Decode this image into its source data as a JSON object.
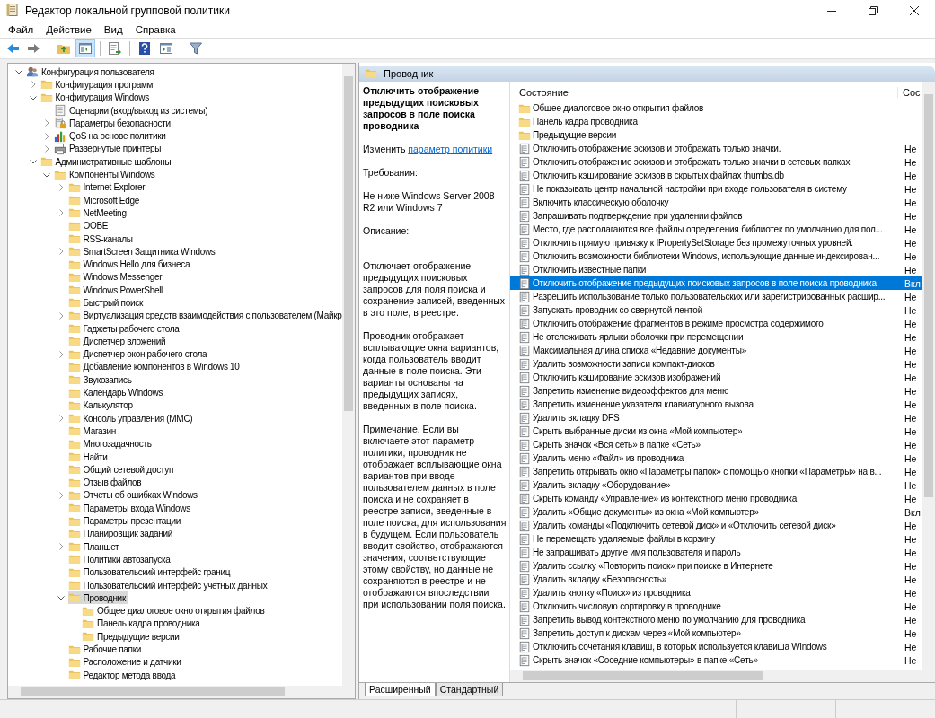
{
  "window": {
    "title": "Редактор локальной групповой политики"
  },
  "menu": [
    "Файл",
    "Действие",
    "Вид",
    "Справка"
  ],
  "toolbar": [
    [
      {
        "kind": "back",
        "pressed": false
      },
      {
        "kind": "forward",
        "pressed": false
      }
    ],
    [
      {
        "kind": "up",
        "pressed": false
      },
      {
        "kind": "tree",
        "pressed": true
      }
    ],
    [
      {
        "kind": "export",
        "pressed": false
      }
    ],
    [
      {
        "kind": "help",
        "pressed": false
      },
      {
        "kind": "pane",
        "pressed": false
      }
    ],
    [
      {
        "kind": "filter",
        "pressed": false
      }
    ]
  ],
  "tree": [
    {
      "label": "Конфигурация пользователя",
      "kind": "user",
      "expanded": true,
      "selected": false,
      "children": [
        {
          "label": "Конфигурация программ",
          "kind": "folder",
          "expanded": false,
          "selected": false
        },
        {
          "label": "Конфигурация Windows",
          "kind": "folder",
          "expanded": true,
          "selected": false,
          "children": [
            {
              "label": "Сценарии (вход/выход из системы)",
              "kind": "script",
              "selected": false
            },
            {
              "label": "Параметры безопасности",
              "kind": "security",
              "expanded": false,
              "selected": false
            },
            {
              "label": "QoS на основе политики",
              "kind": "chart",
              "expanded": false,
              "selected": false
            },
            {
              "label": "Развернутые принтеры",
              "kind": "printer",
              "expanded": false,
              "selected": false
            }
          ]
        },
        {
          "label": "Административные шаблоны",
          "kind": "folder",
          "expanded": true,
          "selected": false,
          "children": [
            {
              "label": "Компоненты Windows",
              "kind": "folder",
              "expanded": true,
              "selected": false,
              "children": [
                {
                  "label": "Internet Explorer",
                  "kind": "folder",
                  "expanded": false,
                  "selected": false
                },
                {
                  "label": "Microsoft Edge",
                  "kind": "folder",
                  "selected": false
                },
                {
                  "label": "NetMeeting",
                  "kind": "folder",
                  "expanded": false,
                  "selected": false
                },
                {
                  "label": "OOBE",
                  "kind": "folder",
                  "selected": false
                },
                {
                  "label": "RSS-каналы",
                  "kind": "folder",
                  "selected": false
                },
                {
                  "label": "SmartScreen Защитника Windows",
                  "kind": "folder",
                  "expanded": false,
                  "selected": false
                },
                {
                  "label": "Windows Hello для бизнеса",
                  "kind": "folder",
                  "selected": false
                },
                {
                  "label": "Windows Messenger",
                  "kind": "folder",
                  "selected": false
                },
                {
                  "label": "Windows PowerShell",
                  "kind": "folder",
                  "selected": false
                },
                {
                  "label": "Быстрый поиск",
                  "kind": "folder",
                  "selected": false
                },
                {
                  "label": "Виртуализация средств взаимодействия с пользователем (Майкр",
                  "kind": "folder",
                  "expanded": false,
                  "selected": false
                },
                {
                  "label": "Гаджеты рабочего стола",
                  "kind": "folder",
                  "selected": false
                },
                {
                  "label": "Диспетчер вложений",
                  "kind": "folder",
                  "selected": false
                },
                {
                  "label": "Диспетчер окон рабочего стола",
                  "kind": "folder",
                  "expanded": false,
                  "selected": false
                },
                {
                  "label": "Добавление компонентов в Windows 10",
                  "kind": "folder",
                  "selected": false
                },
                {
                  "label": "Звукозапись",
                  "kind": "folder",
                  "selected": false
                },
                {
                  "label": "Календарь Windows",
                  "kind": "folder",
                  "selected": false
                },
                {
                  "label": "Калькулятор",
                  "kind": "folder",
                  "selected": false
                },
                {
                  "label": "Консоль управления (MMC)",
                  "kind": "folder",
                  "expanded": false,
                  "selected": false
                },
                {
                  "label": "Магазин",
                  "kind": "folder",
                  "selected": false
                },
                {
                  "label": "Многозадачность",
                  "kind": "folder",
                  "selected": false
                },
                {
                  "label": "Найти",
                  "kind": "folder",
                  "selected": false
                },
                {
                  "label": "Общий сетевой доступ",
                  "kind": "folder",
                  "selected": false
                },
                {
                  "label": "Отзыв файлов",
                  "kind": "folder",
                  "selected": false
                },
                {
                  "label": "Отчеты об ошибках Windows",
                  "kind": "folder",
                  "expanded": false,
                  "selected": false
                },
                {
                  "label": "Параметры входа Windows",
                  "kind": "folder",
                  "selected": false
                },
                {
                  "label": "Параметры презентации",
                  "kind": "folder",
                  "selected": false
                },
                {
                  "label": "Планировщик заданий",
                  "kind": "folder",
                  "selected": false
                },
                {
                  "label": "Планшет",
                  "kind": "folder",
                  "expanded": false,
                  "selected": false
                },
                {
                  "label": "Политики автозапуска",
                  "kind": "folder",
                  "selected": false
                },
                {
                  "label": "Пользовательский интерфейс границ",
                  "kind": "folder",
                  "selected": false
                },
                {
                  "label": "Пользовательский интерфейс учетных данных",
                  "kind": "folder",
                  "selected": false
                },
                {
                  "label": "Проводник",
                  "kind": "folder",
                  "expanded": true,
                  "selected": true,
                  "children": [
                    {
                      "label": "Общее диалоговое окно открытия файлов",
                      "kind": "folder",
                      "selected": false
                    },
                    {
                      "label": "Панель кадра проводника",
                      "kind": "folder",
                      "selected": false
                    },
                    {
                      "label": "Предыдущие версии",
                      "kind": "folder",
                      "selected": false
                    }
                  ]
                },
                {
                  "label": "Рабочие папки",
                  "kind": "folder",
                  "selected": false
                },
                {
                  "label": "Расположение и датчики",
                  "kind": "folder",
                  "selected": false
                },
                {
                  "label": "Редактор метода ввода",
                  "kind": "folder",
                  "selected": false
                }
              ]
            }
          ]
        }
      ]
    }
  ],
  "details": {
    "header": "Проводник",
    "policy_title": "Отключить отображение предыдущих поисковых запросов в поле поиска проводника",
    "edit_prefix": "Изменить",
    "edit_link": "параметр политики",
    "requirements_label": "Требования:",
    "requirements": "Не ниже Windows Server 2008 R2 или Windows 7",
    "description_label": "Описание:",
    "paragraphs": [
      "Отключает отображение предыдущих поисковых запросов для поля поиска и сохранение записей, введенных в это поле, в реестре.",
      "Проводник отображает всплывающие окна вариантов, когда пользователь вводит данные в поле поиска. Эти варианты основаны на предыдущих записях, введенных в поле поиска.",
      "Примечание. Если вы включаете этот параметр политики, проводник не отображает всплывающие окна вариантов при вводе пользователем данных в поле поиска и не сохраняет в реестре записи, введенные в поле поиска, для использования в будущем. Если пользователь вводит свойство, отображаются значения, соответствующие этому свойству, но данные не сохраняются в реестре и не отображаются впоследствии при использовании поля поиска."
    ]
  },
  "list": {
    "columns": [
      "Состояние",
      "Сос"
    ],
    "rows": [
      {
        "kind": "folder",
        "name": "Общее диалоговое окно открытия файлов",
        "selected": false
      },
      {
        "kind": "folder",
        "name": "Панель кадра проводника",
        "selected": false
      },
      {
        "kind": "folder",
        "name": "Предыдущие версии",
        "selected": false
      },
      {
        "kind": "setting",
        "name": "Отключить отображение эскизов и отображать только значки.",
        "state": "Не",
        "selected": false
      },
      {
        "kind": "setting",
        "name": "Отключить отображение эскизов и отображать только значки в сетевых папках",
        "state": "Не",
        "selected": false
      },
      {
        "kind": "setting",
        "name": "Отключить кэширование эскизов в скрытых файлах thumbs.db",
        "state": "Не",
        "selected": false
      },
      {
        "kind": "setting",
        "name": "Не показывать центр начальной настройки при входе пользователя в систему",
        "state": "Не",
        "selected": false
      },
      {
        "kind": "setting",
        "name": "Включить классическую оболочку",
        "state": "Не",
        "selected": false
      },
      {
        "kind": "setting",
        "name": "Запрашивать подтверждение при удалении файлов",
        "state": "Не",
        "selected": false
      },
      {
        "kind": "setting",
        "name": "Место, где располагаются все файлы определения библиотек по умолчанию для пол...",
        "state": "Не",
        "selected": false
      },
      {
        "kind": "setting",
        "name": "Отключить прямую привязку к IPropertySetStorage без промежуточных уровней.",
        "state": "Не",
        "selected": false
      },
      {
        "kind": "setting",
        "name": "Отключить возможности библиотеки Windows, использующие данные индексирован...",
        "state": "Не",
        "selected": false
      },
      {
        "kind": "setting",
        "name": "Отключить известные папки",
        "state": "Не",
        "selected": false
      },
      {
        "kind": "setting",
        "name": "Отключить отображение предыдущих поисковых запросов в поле поиска проводника",
        "state": "Вкл",
        "selected": true
      },
      {
        "kind": "setting",
        "name": "Разрешить использование только пользовательских или зарегистрированных расшир...",
        "state": "Не",
        "selected": false
      },
      {
        "kind": "setting",
        "name": "Запускать проводник со свернутой лентой",
        "state": "Не",
        "selected": false
      },
      {
        "kind": "setting",
        "name": "Отключить отображение фрагментов в режиме просмотра содержимого",
        "state": "Не",
        "selected": false
      },
      {
        "kind": "setting",
        "name": "Не отслеживать ярлыки оболочки при перемещении",
        "state": "Не",
        "selected": false
      },
      {
        "kind": "setting",
        "name": "Максимальная длина списка «Недавние документы»",
        "state": "Не",
        "selected": false
      },
      {
        "kind": "setting",
        "name": "Удалить возможности записи компакт-дисков",
        "state": "Не",
        "selected": false
      },
      {
        "kind": "setting",
        "name": "Отключить кэширование эскизов изображений",
        "state": "Не",
        "selected": false
      },
      {
        "kind": "setting",
        "name": "Запретить изменение видеоэффектов для меню",
        "state": "Не",
        "selected": false
      },
      {
        "kind": "setting",
        "name": "Запретить изменение указателя клавиатурного вызова",
        "state": "Не",
        "selected": false
      },
      {
        "kind": "setting",
        "name": "Удалить вкладку DFS",
        "state": "Не",
        "selected": false
      },
      {
        "kind": "setting",
        "name": "Скрыть выбранные диски из окна «Мой компьютер»",
        "state": "Не",
        "selected": false
      },
      {
        "kind": "setting",
        "name": "Скрыть значок «Вся сеть» в папке «Сеть»",
        "state": "Не",
        "selected": false
      },
      {
        "kind": "setting",
        "name": "Удалить меню «Файл» из проводника",
        "state": "Не",
        "selected": false
      },
      {
        "kind": "setting",
        "name": "Запретить открывать окно «Параметры папок» с помощью кнопки «Параметры» на в...",
        "state": "Не",
        "selected": false
      },
      {
        "kind": "setting",
        "name": "Удалить вкладку «Оборудование»",
        "state": "Не",
        "selected": false
      },
      {
        "kind": "setting",
        "name": "Скрыть команду «Управление» из контекстного меню проводника",
        "state": "Не",
        "selected": false
      },
      {
        "kind": "setting",
        "name": "Удалить «Общие документы» из окна «Мой компьютер»",
        "state": "Вкл",
        "selected": false
      },
      {
        "kind": "setting",
        "name": "Удалить команды «Подключить сетевой диск» и «Отключить сетевой диск»",
        "state": "Не",
        "selected": false
      },
      {
        "kind": "setting",
        "name": "Не перемещать удаляемые файлы в корзину",
        "state": "Не",
        "selected": false
      },
      {
        "kind": "setting",
        "name": "Не запрашивать другие имя пользователя и пароль",
        "state": "Не",
        "selected": false
      },
      {
        "kind": "setting",
        "name": "Удалить ссылку «Повторить поиск» при поиске в Интернете",
        "state": "Не",
        "selected": false
      },
      {
        "kind": "setting",
        "name": "Удалить вкладку «Безопасность»",
        "state": "Не",
        "selected": false
      },
      {
        "kind": "setting",
        "name": "Удалить кнопку «Поиск» из проводника",
        "state": "Не",
        "selected": false
      },
      {
        "kind": "setting",
        "name": "Отключить числовую сортировку в проводнике",
        "state": "Не",
        "selected": false
      },
      {
        "kind": "setting",
        "name": "Запретить вывод контекстного меню по умолчанию для проводника",
        "state": "Не",
        "selected": false
      },
      {
        "kind": "setting",
        "name": "Запретить доступ к дискам через «Мой компьютер»",
        "state": "Не",
        "selected": false
      },
      {
        "kind": "setting",
        "name": "Отключить сочетания клавиш, в которых используется клавиша Windows",
        "state": "Не",
        "selected": false
      },
      {
        "kind": "setting",
        "name": "Скрыть значок «Соседние компьютеры» в папке «Сеть»",
        "state": "Не",
        "selected": false
      }
    ]
  },
  "view_tabs": [
    {
      "label": "Расширенный",
      "selected": true
    },
    {
      "label": "Стандартный",
      "selected": false
    }
  ]
}
